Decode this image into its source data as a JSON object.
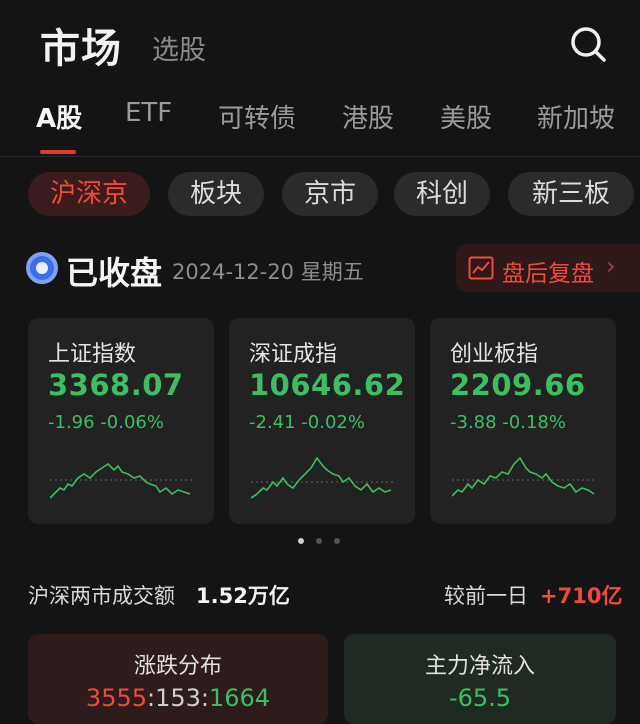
{
  "header": {
    "title": "市场",
    "subtitle": "选股"
  },
  "tabs": [
    "A股",
    "ETF",
    "可转债",
    "港股",
    "美股",
    "新加坡"
  ],
  "chips": [
    "沪深京",
    "板块",
    "京市",
    "科创",
    "新三板"
  ],
  "status": {
    "title": "已收盘",
    "date": "2024-12-20 星期五",
    "after_hours_label": "盘后复盘"
  },
  "indices": [
    {
      "name": "上证指数",
      "value": "3368.07",
      "change": "-1.96  -0.06%"
    },
    {
      "name": "深证成指",
      "value": "10646.62",
      "change": "-2.41  -0.02%"
    },
    {
      "name": "创业板指",
      "value": "2209.66",
      "change": "-3.88  -0.18%"
    }
  ],
  "turnover": {
    "label": "沪深两市成交额",
    "value": "1.52万亿",
    "compare_label": "较前一日",
    "compare_value": "+710亿"
  },
  "distribution": {
    "title": "涨跌分布",
    "up": "3555",
    "flat": "153",
    "down": "1664"
  },
  "net_inflow": {
    "title": "主力净流入",
    "value": "-65.5"
  },
  "colors": {
    "up": "#ef4a3c",
    "down": "#3bbf62",
    "accent": "#e8382e"
  }
}
